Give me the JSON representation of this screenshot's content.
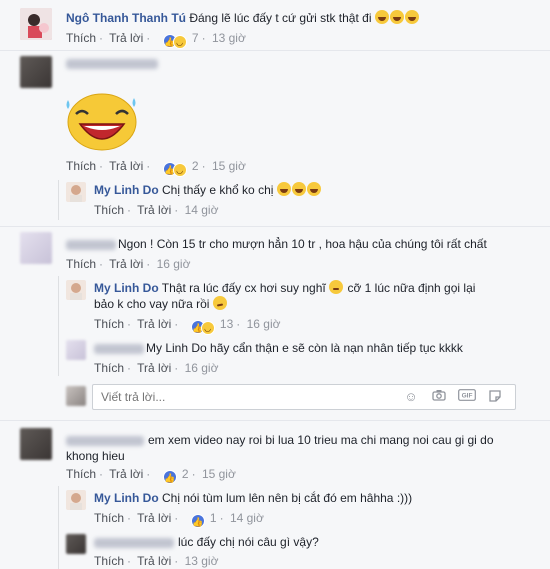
{
  "actions": {
    "like": "Thích",
    "reply": "Trả lời"
  },
  "comments": [
    {
      "name": "Ngô Thanh Thanh Tú",
      "text": "Đáng lẽ lúc đấy t cứ gửi stk thật đi",
      "count": "7",
      "time": "13 giờ"
    },
    {
      "count": "2",
      "time": "15 giờ"
    },
    {
      "name": "My Linh Do",
      "text": "Chị thấy e khổ ko chị",
      "time": "14 giờ"
    },
    {
      "text": "Ngon ! Còn 15 tr cho mượn hẳn 10 tr , hoa hậu của chúng tôi rất chất",
      "time": "16 giờ"
    },
    {
      "name": "My Linh Do",
      "text_1": "Thật ra lúc đấy cx hơi suy nghĩ",
      "text_2": "cỡ 1 lúc nữa định gọi lại",
      "text_3": "bảo k cho vay nữa rồi",
      "count": "13",
      "time": "16 giờ"
    },
    {
      "text": "My Linh Do hãy cẩn thận e sẽ còn là nạn nhân tiếp tục kkkk",
      "time": "16 giờ"
    },
    {
      "text_1": "em xem video nay roi bi lua 10 trieu ma chi mang noi cau gi gi do",
      "text_2": "khong hieu",
      "count": "2",
      "time": "15 giờ"
    },
    {
      "name": "My Linh Do",
      "text": "Chị nói tùm lum lên nên bị cắt đó em hâhha :)))",
      "count": "1",
      "time": "14 giờ"
    },
    {
      "text": "lúc đấy chị nói câu gì vậy?",
      "time": "13 giờ"
    }
  ],
  "reply_box": {
    "placeholder": "Viết trả lời..."
  },
  "colors": {
    "link": "#365899",
    "meta": "#90949c",
    "like_blue": "#4a74dc",
    "haha_yellow": "#f7c93c",
    "background": "#f6f7f9"
  },
  "icons": [
    "like-icon",
    "haha-icon",
    "smile-emoji-icon",
    "camera-icon",
    "gif-icon",
    "sticker-icon"
  ]
}
